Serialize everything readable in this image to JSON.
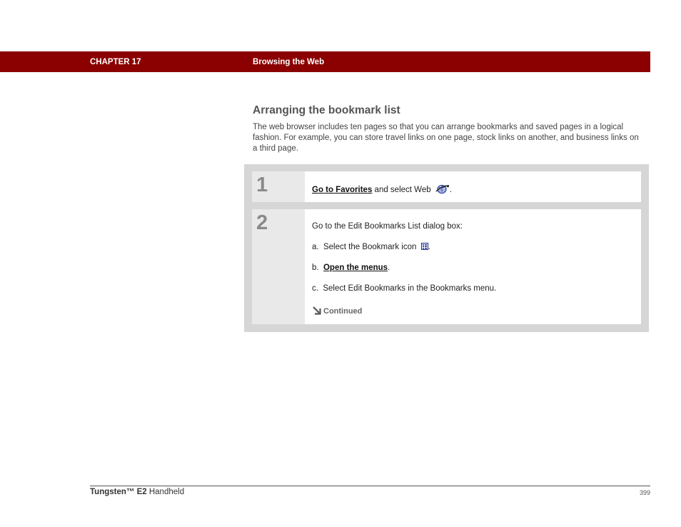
{
  "header": {
    "chapter": "CHAPTER 17",
    "title": "Browsing the Web"
  },
  "section": {
    "title": "Arranging the bookmark list",
    "intro": "The web browser includes ten pages so that you can arrange bookmarks and saved pages in a logical fashion. For example, you can store travel links on one page, stock links on another, and business links on a third page."
  },
  "steps": [
    {
      "number": "1",
      "link_text": "Go to Favorites",
      "text_after_link": " and select Web",
      "text_end": ".",
      "icon": "web-browser-icon"
    },
    {
      "number": "2",
      "intro": "Go to the Edit Bookmarks List dialog box:",
      "substeps": [
        {
          "marker": "a.",
          "text": "Select the Bookmark icon",
          "end": ".",
          "icon": "bookmark-icon"
        },
        {
          "marker": "b.",
          "link_text": "Open the menus",
          "end": "."
        },
        {
          "marker": "c.",
          "text": "Select Edit Bookmarks in the Bookmarks menu."
        }
      ],
      "continued": "Continued",
      "continued_icon": "arrow-down-right-icon"
    }
  ],
  "footer": {
    "product_bold": "Tungsten™ E2",
    "product_rest": " Handheld",
    "page_number": "399"
  },
  "colors": {
    "header_bg": "#8b0000",
    "panel_bg": "#d6d6d6",
    "step_number_bg": "#e9e9e9"
  }
}
